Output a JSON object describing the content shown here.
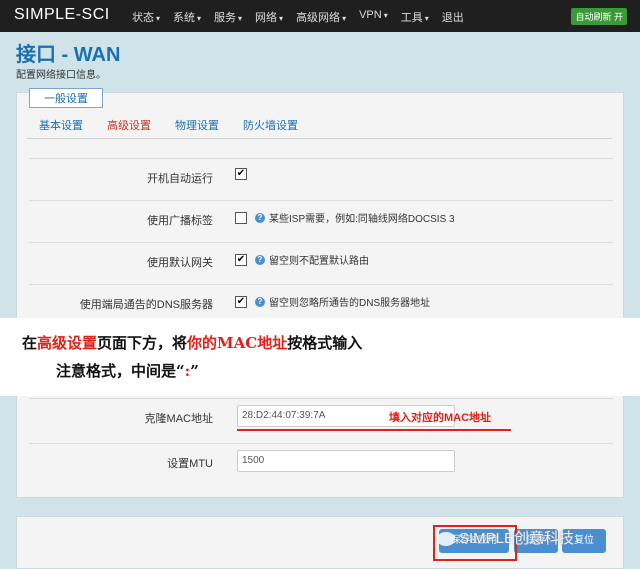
{
  "topbar": {
    "brand": "SIMPLE-SCI",
    "nav": [
      {
        "label": "状态",
        "caret": "▾"
      },
      {
        "label": "系统",
        "caret": "▾"
      },
      {
        "label": "服务",
        "caret": "▾"
      },
      {
        "label": "网络",
        "caret": "▾"
      },
      {
        "label": "高级网络",
        "caret": "▾"
      },
      {
        "label": "VPN",
        "caret": "▾"
      },
      {
        "label": "工具",
        "caret": "▾"
      },
      {
        "label": "退出",
        "caret": ""
      }
    ],
    "refresh_badge": "自动刷新 开"
  },
  "page": {
    "title": "接口 - WAN",
    "description": "配置网络接口信息。"
  },
  "panel": {
    "legend": "一般设置",
    "tabs": [
      "基本设置",
      "高级设置",
      "物理设置",
      "防火墙设置"
    ],
    "active_tab": "高级设置"
  },
  "rows": [
    {
      "label": "开机自动运行",
      "checked": true,
      "check_mark": "✔",
      "hint": ""
    },
    {
      "label": "使用广播标签",
      "checked": false,
      "check_mark": "",
      "hint": "某些ISP需要，例如:同轴线网络DOCSIS 3"
    },
    {
      "label": "使用默认网关",
      "checked": true,
      "check_mark": "✔",
      "hint": "留空则不配置默认路由"
    },
    {
      "label": "使用端局通告的DNS服务器",
      "checked": true,
      "check_mark": "✔",
      "hint": "留空则忽略所通告的DNS服务器地址"
    }
  ],
  "mac_row": {
    "label": "克隆MAC地址",
    "value": "28:D2:44:07:39:7A",
    "annotation": "填入对应的MAC地址"
  },
  "mtu_row": {
    "label": "设置MTU",
    "value": "1500"
  },
  "overlay": {
    "p1": "在",
    "p2": "高级设置",
    "p3": "页面下方，将",
    "p4": "你的MAC地址",
    "p5": "按格式输入",
    "p6": "注意格式，中间是“",
    "p7": ":",
    "p8": "”"
  },
  "footer": {
    "btn_apply": "保存&应用",
    "btn_save": "保存",
    "btn_reset": "复位",
    "watermark": "SIMPLE创意科技"
  },
  "colors": {
    "accent": "#1b6fb3",
    "annotation_red": "#e0221a",
    "button_blue": "#4a8fd0"
  }
}
